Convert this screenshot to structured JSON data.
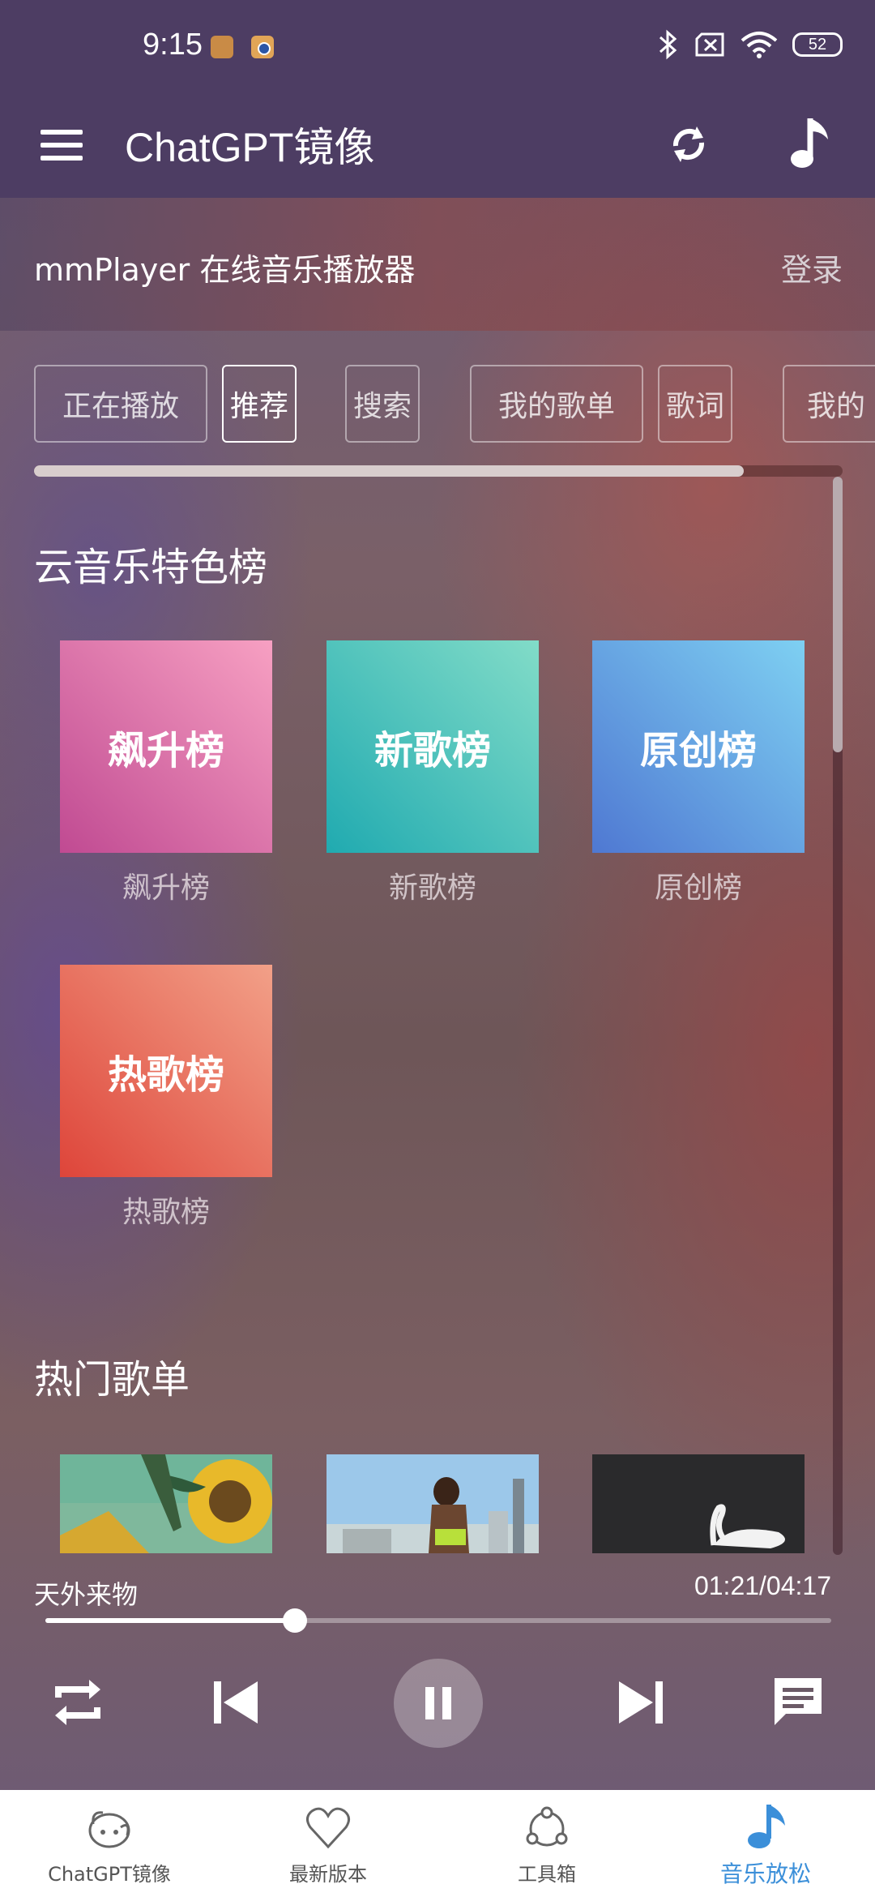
{
  "status_bar": {
    "time": "9:15",
    "battery": "52"
  },
  "app_bar": {
    "title": "ChatGPT镜像"
  },
  "header": {
    "player_title": "mmPlayer 在线音乐播放器",
    "login": "登录"
  },
  "tabs": [
    {
      "label": "正在播放"
    },
    {
      "label": "推荐"
    },
    {
      "label": "搜索"
    },
    {
      "label": "我的歌单"
    },
    {
      "label": "歌词"
    },
    {
      "label": "我的"
    }
  ],
  "sections": {
    "charts_title": "云音乐特色榜",
    "charts": [
      {
        "cover_text": "飙升榜",
        "caption": "飙升榜",
        "gradient": [
          "#d24a9a",
          "#f7a0c2"
        ]
      },
      {
        "cover_text": "新歌榜",
        "caption": "新歌榜",
        "gradient": [
          "#1fb0b0",
          "#82dcc8"
        ]
      },
      {
        "cover_text": "原创榜",
        "caption": "原创榜",
        "gradient": [
          "#4f78d2",
          "#7ed0f2"
        ]
      },
      {
        "cover_text": "热歌榜",
        "caption": "热歌榜",
        "gradient": [
          "#e0453a",
          "#f2a088"
        ]
      }
    ],
    "playlists_title": "热门歌单"
  },
  "player": {
    "song": "天外来物",
    "time": "01:21/04:17",
    "progress": 0.318
  },
  "bottom_nav": [
    {
      "label": "ChatGPT镜像",
      "icon": "avatar-face-icon"
    },
    {
      "label": "最新版本",
      "icon": "heart-icon"
    },
    {
      "label": "工具箱",
      "icon": "share-nodes-icon"
    },
    {
      "label": "音乐放松",
      "icon": "music-note-icon",
      "active": true
    }
  ]
}
